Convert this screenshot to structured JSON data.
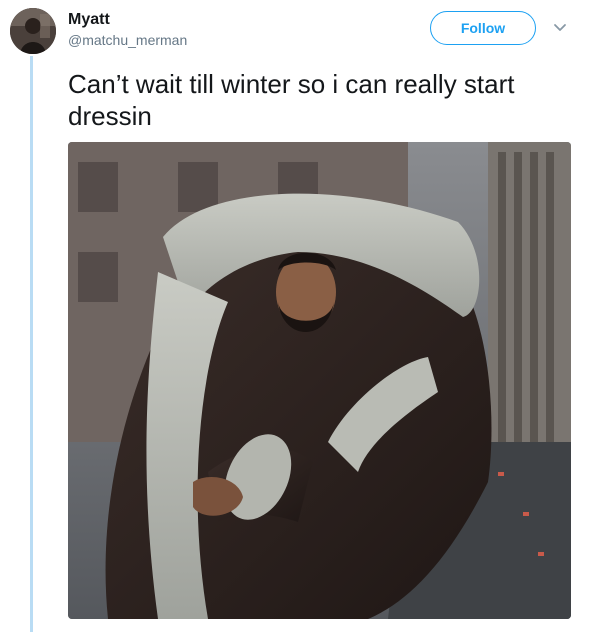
{
  "tweet": {
    "author_name": "Myatt",
    "handle": "@matchu_merman",
    "follow_label": "Follow",
    "text": "Can’t wait till winter so i can really start dressin"
  },
  "icons": {
    "more": "chevron-down-icon"
  },
  "colors": {
    "accent": "#1da1f2",
    "thread_line": "#b9dcf4",
    "secondary_text": "#657786"
  }
}
